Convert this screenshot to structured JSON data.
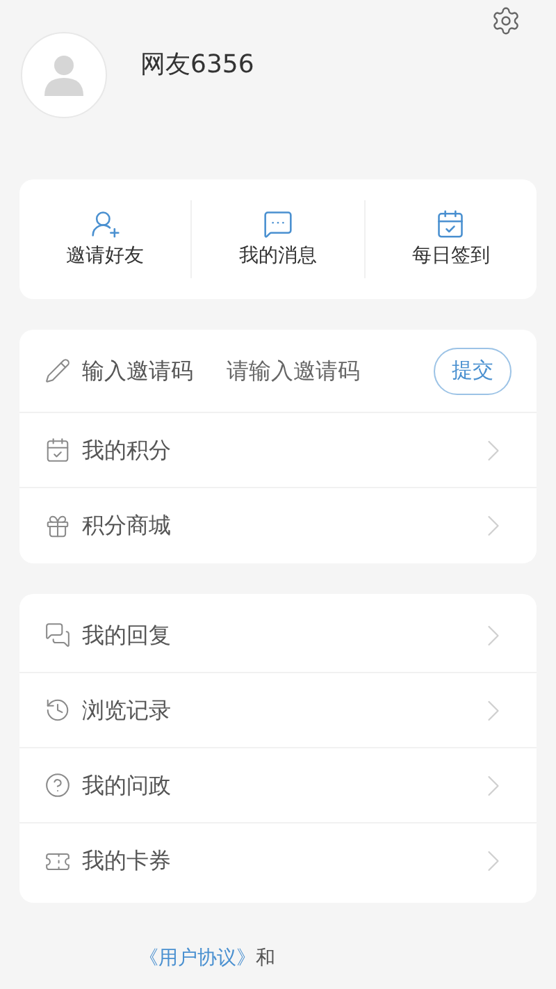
{
  "profile": {
    "username": "网友6356"
  },
  "quick_actions": [
    {
      "label": "邀请好友"
    },
    {
      "label": "我的消息"
    },
    {
      "label": "每日签到"
    }
  ],
  "points_section": [
    {
      "kind": "input",
      "label": "输入邀请码",
      "placeholder": "请输入邀请码",
      "button": "提交"
    },
    {
      "kind": "link",
      "label": "我的积分"
    },
    {
      "kind": "link",
      "label": "积分商城"
    }
  ],
  "activity_section": [
    {
      "kind": "link",
      "label": "我的回复"
    },
    {
      "kind": "link",
      "label": "浏览记录"
    },
    {
      "kind": "link",
      "label": "我的问政"
    },
    {
      "kind": "link",
      "label": "我的卡券"
    }
  ],
  "footer": {
    "agreement_link": "《用户协议》",
    "connector": "和"
  }
}
